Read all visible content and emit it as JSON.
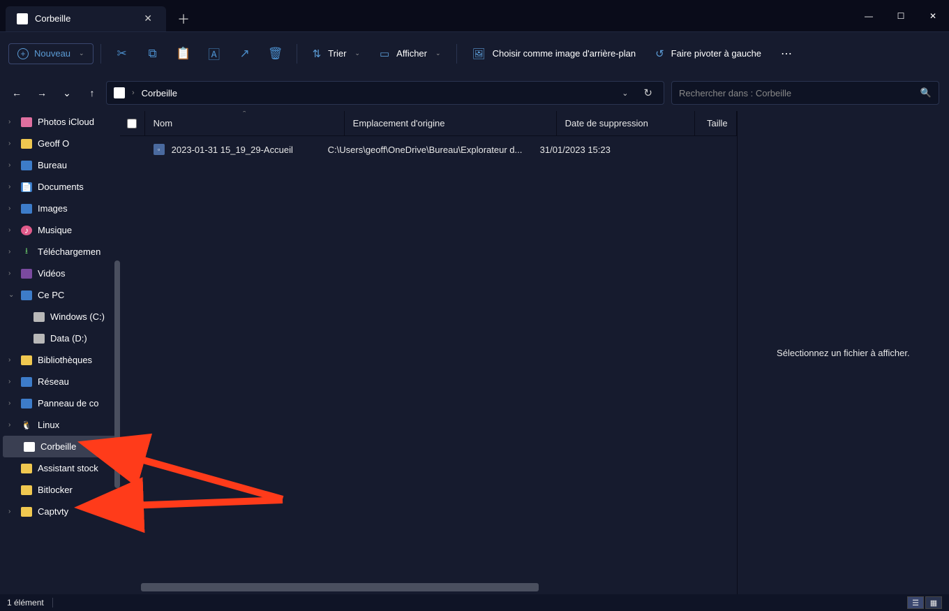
{
  "titlebar": {
    "tab_title": "Corbeille",
    "close_glyph": "✕",
    "new_tab_glyph": "＋",
    "minimize_glyph": "—",
    "maximize_glyph": "☐",
    "winclose_glyph": "✕"
  },
  "toolbar": {
    "new_label": "Nouveau",
    "sort_label": "Trier",
    "view_label": "Afficher",
    "wallpaper_label": "Choisir comme image d'arrière-plan",
    "rotate_label": "Faire pivoter à gauche"
  },
  "navbar": {
    "breadcrumb": "Corbeille",
    "search_placeholder": "Rechercher dans : Corbeille"
  },
  "sidebar": {
    "items": [
      {
        "label": "Photos iCloud",
        "iconClass": "icon-pink",
        "chev": "›",
        "indent": false
      },
      {
        "label": "Geoff O",
        "iconClass": "folder-y",
        "chev": "›",
        "indent": false
      },
      {
        "label": "Bureau",
        "iconClass": "folder-b",
        "chev": "›",
        "indent": false
      },
      {
        "label": "Documents",
        "iconClass": "folder-b",
        "chev": "›",
        "indent": false,
        "glyph": "📄"
      },
      {
        "label": "Images",
        "iconClass": "icon-img",
        "chev": "›",
        "indent": false
      },
      {
        "label": "Musique",
        "iconClass": "icon-music",
        "chev": "›",
        "indent": false,
        "glyph": "♪"
      },
      {
        "label": "Téléchargemen",
        "iconClass": "icon-dl",
        "chev": "›",
        "indent": false,
        "glyph": "⭳"
      },
      {
        "label": "Vidéos",
        "iconClass": "icon-video",
        "chev": "›",
        "indent": false
      },
      {
        "label": "Ce PC",
        "iconClass": "icon-pc",
        "chev": "⌄",
        "indent": false,
        "expanded": true
      },
      {
        "label": "Windows (C:)",
        "iconClass": "icon-drive",
        "chev": "",
        "indent": true
      },
      {
        "label": "Data (D:)",
        "iconClass": "icon-drive",
        "chev": "",
        "indent": true
      },
      {
        "label": "Bibliothèques",
        "iconClass": "folder-y",
        "chev": "›",
        "indent": false
      },
      {
        "label": "Réseau",
        "iconClass": "icon-net",
        "chev": "›",
        "indent": false
      },
      {
        "label": "Panneau de co",
        "iconClass": "icon-panel",
        "chev": "›",
        "indent": false
      },
      {
        "label": "Linux",
        "iconClass": "icon-linux",
        "chev": "›",
        "indent": false,
        "glyph": "🐧"
      },
      {
        "label": "Corbeille",
        "iconClass": "icon-bin",
        "chev": "",
        "indent": false,
        "selected": true,
        "glyph": "🗑"
      },
      {
        "label": "Assistant stock",
        "iconClass": "folder-y",
        "chev": "",
        "indent": false
      },
      {
        "label": "Bitlocker",
        "iconClass": "folder-y",
        "chev": "",
        "indent": false
      },
      {
        "label": "Captvty",
        "iconClass": "folder-y",
        "chev": "›",
        "indent": false
      }
    ]
  },
  "filelist": {
    "columns": {
      "name": "Nom",
      "location": "Emplacement d'origine",
      "delete_date": "Date de suppression",
      "size": "Taille"
    },
    "rows": [
      {
        "name": "2023-01-31 15_19_29-Accueil",
        "location": "C:\\Users\\geoff\\OneDrive\\Bureau\\Explorateur d...",
        "delete_date": "31/01/2023 15:23",
        "size": ""
      }
    ]
  },
  "preview": {
    "empty_text": "Sélectionnez un fichier à afficher."
  },
  "statusbar": {
    "count_text": "1 élément"
  }
}
